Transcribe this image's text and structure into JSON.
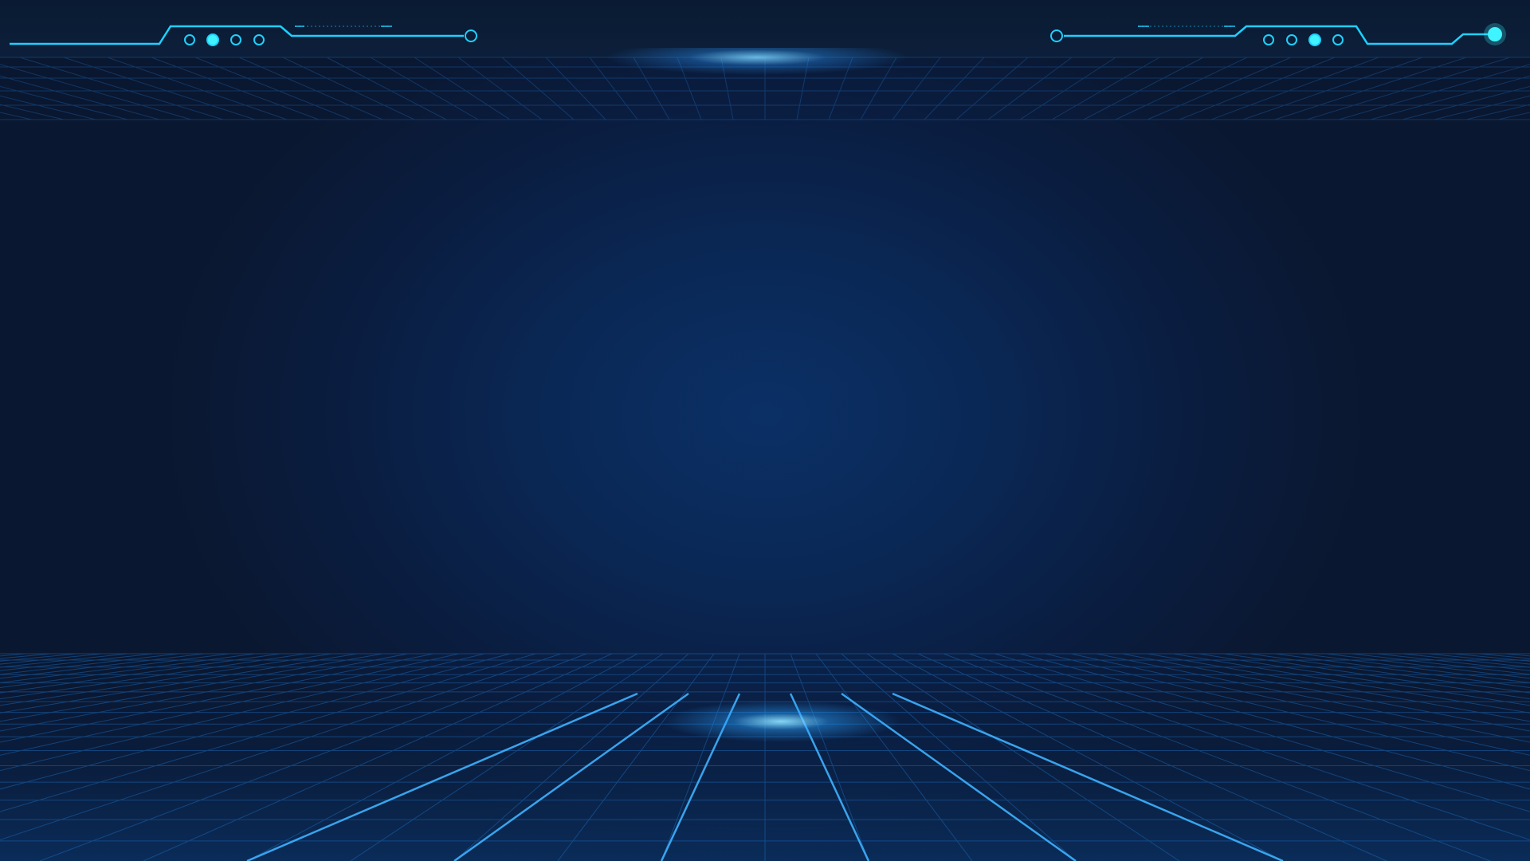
{
  "colors": {
    "accent": "#1fd0ff",
    "accent_bright": "#3ff3ff",
    "grid": "#1c73c8",
    "background_center": "#0b3066",
    "background_edge": "#0a1730"
  },
  "decorations": {
    "left_panel_dots": [
      false,
      true,
      false,
      false
    ],
    "right_panel_dots": [
      false,
      false,
      true,
      false
    ]
  }
}
